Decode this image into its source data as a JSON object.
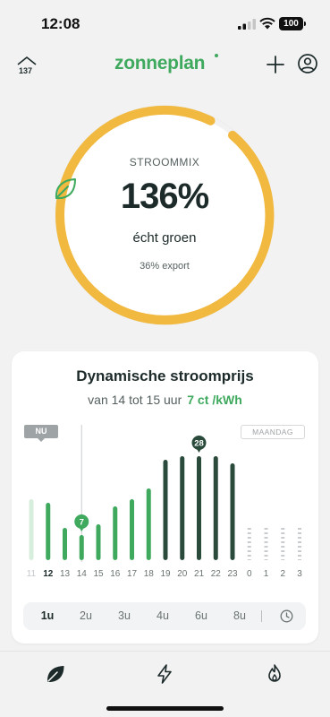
{
  "status_bar": {
    "time": "12:08",
    "battery": "100"
  },
  "header": {
    "home_count": "137",
    "logo": "zonneplan"
  },
  "stroommix": {
    "label": "STROOMMIX",
    "percentage": "136%",
    "subtitle": "écht groen",
    "export": "36% export"
  },
  "price_card": {
    "title": "Dynamische stroomprijs",
    "range_text": "van 14 tot 15 uur",
    "price": "7 ct",
    "unit": "/kWh",
    "now_badge": "NU",
    "day_badge": "MAANDAG",
    "current_marker": "7",
    "peak_marker": "28"
  },
  "chart_data": {
    "type": "bar",
    "categories": [
      "11",
      "12",
      "13",
      "14",
      "15",
      "16",
      "17",
      "18",
      "19",
      "20",
      "21",
      "22",
      "23",
      "0",
      "1",
      "2",
      "3"
    ],
    "values": [
      17,
      16,
      9,
      7,
      10,
      15,
      17,
      20,
      28,
      29,
      29,
      29,
      27,
      null,
      null,
      null,
      null
    ],
    "ylim": [
      0,
      30
    ],
    "current_index": 3,
    "peak_index": 10,
    "colors": {
      "past": "#d8eedd",
      "cheap": "#3fa95e",
      "expensive": "#2a4a3c",
      "unknown": "#c8cccf"
    }
  },
  "ranges": [
    "1u",
    "2u",
    "3u",
    "4u",
    "6u",
    "8u"
  ],
  "active_range": "1u",
  "colors": {
    "green": "#3fa95e",
    "gauge": "#f1b93f",
    "dark": "#1d2a2a"
  }
}
